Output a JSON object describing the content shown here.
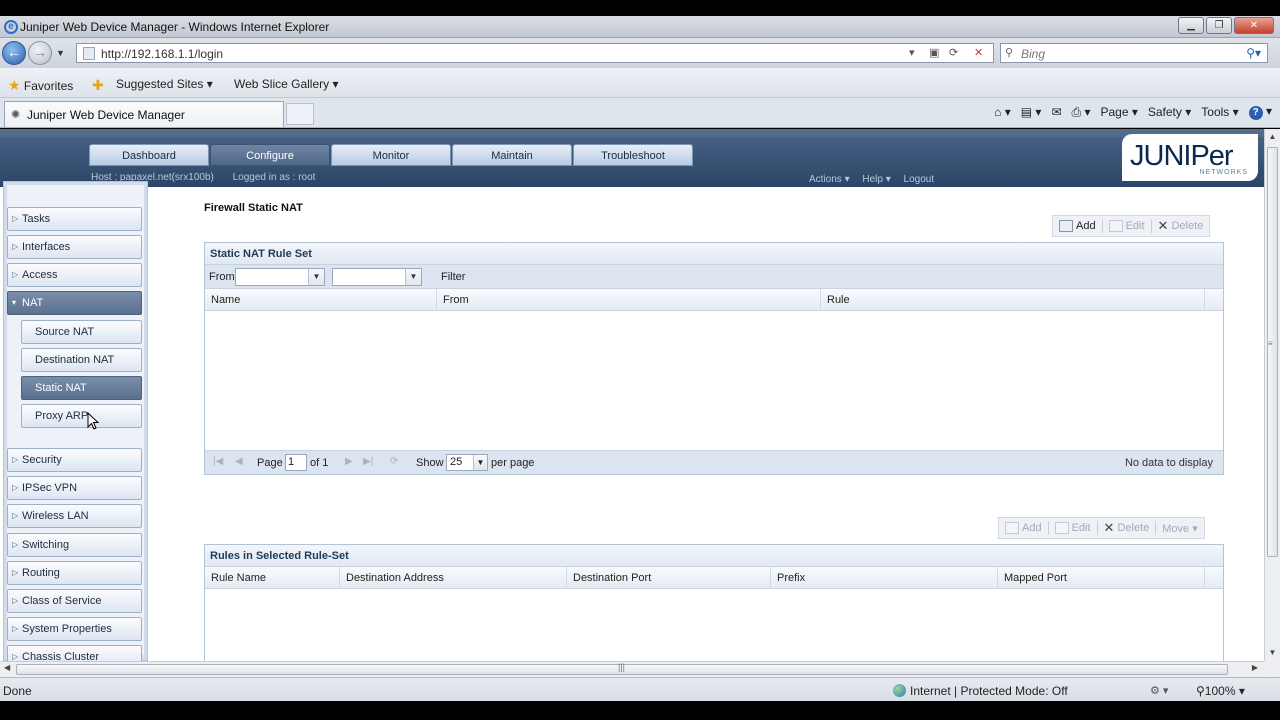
{
  "browser": {
    "window_title": "Juniper Web Device Manager - Windows Internet Explorer",
    "url": "http://192.168.1.1/login",
    "search_placeholder": "Bing",
    "favorites_label": "Favorites",
    "suggested_sites": "Suggested Sites ▾",
    "web_slice_gallery": "Web Slice Gallery ▾",
    "tab_title": "Juniper Web Device Manager",
    "cmd_page": "Page ▾",
    "cmd_safety": "Safety ▾",
    "cmd_tools": "Tools ▾",
    "status_done": "Done",
    "status_zone": "Internet | Protected Mode: Off",
    "zoom": "100%"
  },
  "header": {
    "tabs": [
      "Dashboard",
      "Configure",
      "Monitor",
      "Maintain",
      "Troubleshoot"
    ],
    "active_tab": "Configure",
    "host": "Host : papaxel.net(srx100b)",
    "logged_in": "Logged in as : root",
    "actions": "Actions ▾",
    "help": "Help ▾",
    "logout": "Logout",
    "logo_text": "JUNIPer",
    "logo_sub": "NETWORKS"
  },
  "sidebar": {
    "items": [
      {
        "label": "Tasks"
      },
      {
        "label": "Interfaces"
      },
      {
        "label": "Access"
      },
      {
        "label": "NAT"
      },
      {
        "label": "Security"
      },
      {
        "label": "IPSec VPN"
      },
      {
        "label": "Wireless LAN"
      },
      {
        "label": "Switching"
      },
      {
        "label": "Routing"
      },
      {
        "label": "Class of Service"
      },
      {
        "label": "System Properties"
      },
      {
        "label": "Chassis Cluster"
      }
    ],
    "nat_sub": [
      {
        "label": "Source NAT"
      },
      {
        "label": "Destination NAT"
      },
      {
        "label": "Static NAT"
      },
      {
        "label": "Proxy ARP"
      }
    ]
  },
  "main": {
    "page_title": "Firewall Static NAT",
    "top_toolbar": {
      "add": "Add",
      "edit": "Edit",
      "delete": "Delete"
    },
    "ruleset_grid": {
      "title": "Static NAT Rule Set",
      "from_label": "From",
      "filter_label": "Filter",
      "columns": [
        "Name",
        "From",
        "Rule"
      ],
      "pager": {
        "page_label": "Page",
        "page_value": "1",
        "of_label": "of 1",
        "show_label": "Show",
        "show_value": "25",
        "per_page": "per page",
        "no_data": "No data to display"
      }
    },
    "bottom_toolbar": {
      "add": "Add",
      "edit": "Edit",
      "delete": "Delete",
      "move": "Move ▾"
    },
    "rules_grid": {
      "title": "Rules in Selected Rule-Set",
      "columns": [
        "Rule Name",
        "Destination Address",
        "Destination Port",
        "Prefix",
        "Mapped Port"
      ]
    }
  }
}
